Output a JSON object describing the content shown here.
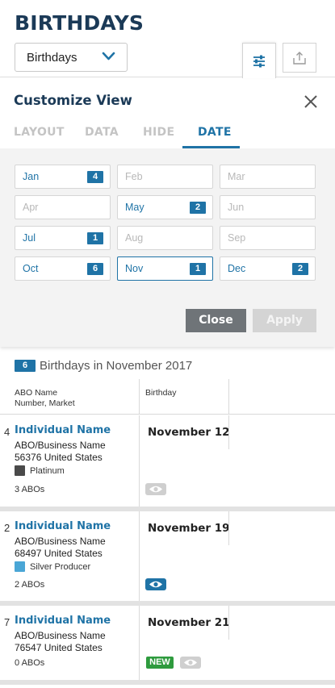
{
  "header": {
    "title": "BIRTHDAYS",
    "dropdown_value": "Birthdays"
  },
  "toolbar": {
    "filter_icon": "sliders-icon",
    "share_icon": "share-upload-icon"
  },
  "customize": {
    "title": "Customize View",
    "tabs": [
      "LAYOUT",
      "DATA",
      "HIDE",
      "DATE"
    ],
    "active_tab": "DATE",
    "months": [
      {
        "label": "Jan",
        "count": "4"
      },
      {
        "label": "Feb",
        "count": ""
      },
      {
        "label": "Mar",
        "count": ""
      },
      {
        "label": "Apr",
        "count": ""
      },
      {
        "label": "May",
        "count": "2"
      },
      {
        "label": "Jun",
        "count": ""
      },
      {
        "label": "Jul",
        "count": "1"
      },
      {
        "label": "Aug",
        "count": ""
      },
      {
        "label": "Sep",
        "count": ""
      },
      {
        "label": "Oct",
        "count": "6"
      },
      {
        "label": "Nov",
        "count": "1"
      },
      {
        "label": "Dec",
        "count": "2"
      }
    ],
    "selected_month": "Nov",
    "close_label": "Close",
    "apply_label": "Apply"
  },
  "results": {
    "count": "6",
    "text": "Birthdays in November 2017",
    "col_name_line1": "ABO Name",
    "col_name_line2": "Number, Market",
    "col_birthday": "Birthday"
  },
  "rows": [
    {
      "rank": "4",
      "name": "Individual Name",
      "business": "ABO/Business Name",
      "number_market": "56376  United States",
      "level": "Platinum",
      "level_color": "#4a4a4a",
      "abos": "3 ABOs",
      "date": "November 12",
      "eye_active": false,
      "new": false
    },
    {
      "rank": "2",
      "name": "Individual Name",
      "business": "ABO/Business Name",
      "number_market": "68497  United States",
      "level": "Silver Producer",
      "level_color": "#4aa6d6",
      "abos": "2 ABOs",
      "date": "November 19",
      "eye_active": true,
      "new": false
    },
    {
      "rank": "7",
      "name": "Individual Name",
      "business": "ABO/Business Name",
      "number_market": "76547  United States",
      "level": "",
      "level_color": "",
      "abos": "0 ABOs",
      "date": "November 21",
      "eye_active": false,
      "new": true,
      "new_label": "NEW"
    }
  ],
  "colors": {
    "brand_navy": "#1b3a57",
    "accent_blue": "#1f73a6",
    "new_green": "#2e9b3e"
  }
}
